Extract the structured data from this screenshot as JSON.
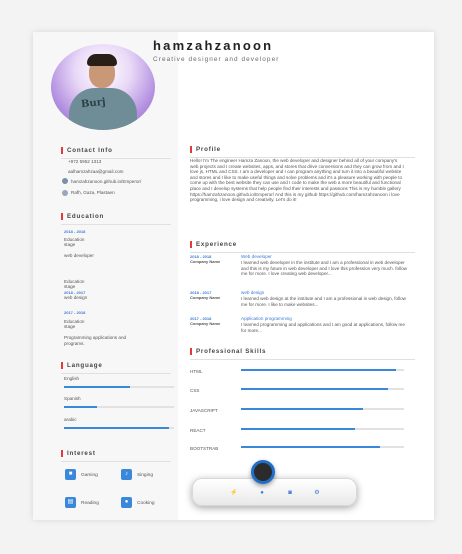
{
  "header": {
    "name": "hamzahzanoon",
    "tagline": "Creative designer and developer",
    "photo_text": "Burj"
  },
  "contact": {
    "title": "Contact Info",
    "phone": "+972 5952 1313",
    "email": "aalhamzahzaa@gmail.com",
    "website": "hamzahzanoon.github.io/Emperor/",
    "location": "Rafh, Gaza, Plastaen"
  },
  "education": {
    "title": "Education",
    "items": [
      {
        "date": "2018 - 2018",
        "line1": "Education",
        "line2": "stage",
        "field": "web developer"
      },
      {
        "date": "2018 - 2017",
        "line1": "Education",
        "line2": "stage",
        "field": "web design"
      },
      {
        "date": "2017 - 2018",
        "line1": "Education",
        "line2": "stage",
        "field": "Programming applications and programs."
      }
    ]
  },
  "language": {
    "title": "Language",
    "items": [
      {
        "name": "English",
        "level": 0.6
      },
      {
        "name": "Spanish",
        "level": 0.3
      },
      {
        "name": "arabic",
        "level": 0.95
      }
    ]
  },
  "interest": {
    "title": "Interest",
    "items": [
      {
        "name": "Gaming",
        "icon": "gamepad-icon"
      },
      {
        "name": "Singing",
        "icon": "microphone-icon"
      },
      {
        "name": "Reading",
        "icon": "book-icon"
      },
      {
        "name": "Cooking",
        "icon": "cooking-icon"
      }
    ]
  },
  "profile": {
    "title": "Profile",
    "text": "Hello! I'm The engineer Hamza Zanoon, the web developer and designer behind all of your company's web projects and I create websites, apps, and stores that drive conversions and they can grow from and I love js, HTML and CSS. I am a developer and I can program anything and turn it into a beautiful website and stores and I like to make useful things and solve problems and it's a pleasure working with people to come up with the best website they can use and I code to make the web a more beautiful and functional place and I develop systems that help people find their interests and passions This is my humble gallery https://hamzahzanoon.github.io/Emperor/ And this is my github https://github.com/hamzahzanoon i love programming, i love design and creativity. Let's do it!"
  },
  "experience": {
    "title": "Experience",
    "items": [
      {
        "date": "2018 - 2018",
        "company": "Company Name",
        "role": "Web developer",
        "desc": "I learned web developer in the institute and I am a professional in web developer and this is my future in web developer and I love this profession very much. follow me for more. I love creating web developer..."
      },
      {
        "date": "2018 - 2017",
        "company": "Company Name",
        "role": "web design",
        "desc": "I learned web design at the institute and I am a professional in web design, follow me for more. I like to make websites..."
      },
      {
        "date": "2017 - 2018",
        "company": "Company Name",
        "role": "Application programming",
        "desc": "I learned programming and applications and I am good at applications, follow me for more..."
      }
    ]
  },
  "skills": {
    "title": "Professional Skills",
    "items": [
      {
        "name": "HTML",
        "level": 0.95
      },
      {
        "name": "CSS",
        "level": 0.9
      },
      {
        "name": "JAVASCRIPT",
        "level": 0.75
      },
      {
        "name": "REACT",
        "level": 0.7
      },
      {
        "name": "BOOTSTRAB",
        "level": 0.85
      }
    ]
  },
  "toolbar": {
    "items": [
      {
        "icon": "bolt-icon",
        "glyph": "⚡"
      },
      {
        "icon": "user-icon",
        "glyph": "●"
      },
      {
        "icon": "camera-icon",
        "glyph": "◙"
      },
      {
        "icon": "settings-icon",
        "glyph": "⚙"
      }
    ]
  },
  "colors": {
    "accent": "#3a88d9",
    "section_marker": "#e53935",
    "fab_border": "#1f6fc9"
  }
}
